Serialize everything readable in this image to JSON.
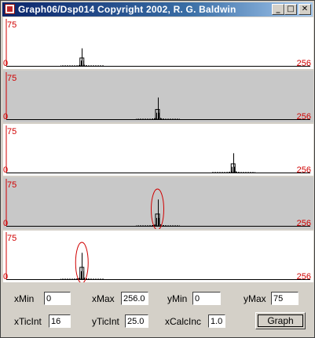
{
  "window": {
    "title": "Graph06/Dsp014 Copyright 2002, R. G. Baldwin"
  },
  "titlebar_buttons": {
    "minimize": "_",
    "maximize": "□",
    "close": "✕"
  },
  "colors": {
    "label_red": "#d00000",
    "panel_white": "#ffffff",
    "panel_gray": "#c8c8c8",
    "trace": "#000000",
    "circle": "#d00000"
  },
  "axis_labels": {
    "ymax": "75",
    "zero": "0",
    "xmax": "256"
  },
  "chart_data": [
    {
      "type": "bar",
      "xlim": [
        0,
        256
      ],
      "ylim": [
        0,
        75
      ],
      "peak_x": 64,
      "peak_y": 30,
      "background": "white",
      "circled": false
    },
    {
      "type": "bar",
      "xlim": [
        0,
        256
      ],
      "ylim": [
        0,
        75
      ],
      "peak_x": 128,
      "peak_y": 37,
      "background": "gray",
      "circled": false
    },
    {
      "type": "bar",
      "xlim": [
        0,
        256
      ],
      "ylim": [
        0,
        75
      ],
      "peak_x": 192,
      "peak_y": 33,
      "background": "white",
      "circled": false
    },
    {
      "type": "bar",
      "xlim": [
        0,
        256
      ],
      "ylim": [
        0,
        75
      ],
      "peak_x": 128,
      "peak_y": 45,
      "background": "gray",
      "circled": true
    },
    {
      "type": "bar",
      "xlim": [
        0,
        256
      ],
      "ylim": [
        0,
        75
      ],
      "peak_x": 64,
      "peak_y": 45,
      "background": "white",
      "circled": true
    }
  ],
  "controls": {
    "xMin": {
      "label": "xMin",
      "value": "0"
    },
    "xMax": {
      "label": "xMax",
      "value": "256.0"
    },
    "yMin": {
      "label": "yMin",
      "value": "0"
    },
    "yMax": {
      "label": "yMax",
      "value": "75"
    },
    "xTicInt": {
      "label": "xTicInt",
      "value": "16"
    },
    "yTicInt": {
      "label": "yTicInt",
      "value": "25.0"
    },
    "xCalcInc": {
      "label": "xCalcInc",
      "value": "1.0"
    },
    "graph_button": "Graph"
  }
}
